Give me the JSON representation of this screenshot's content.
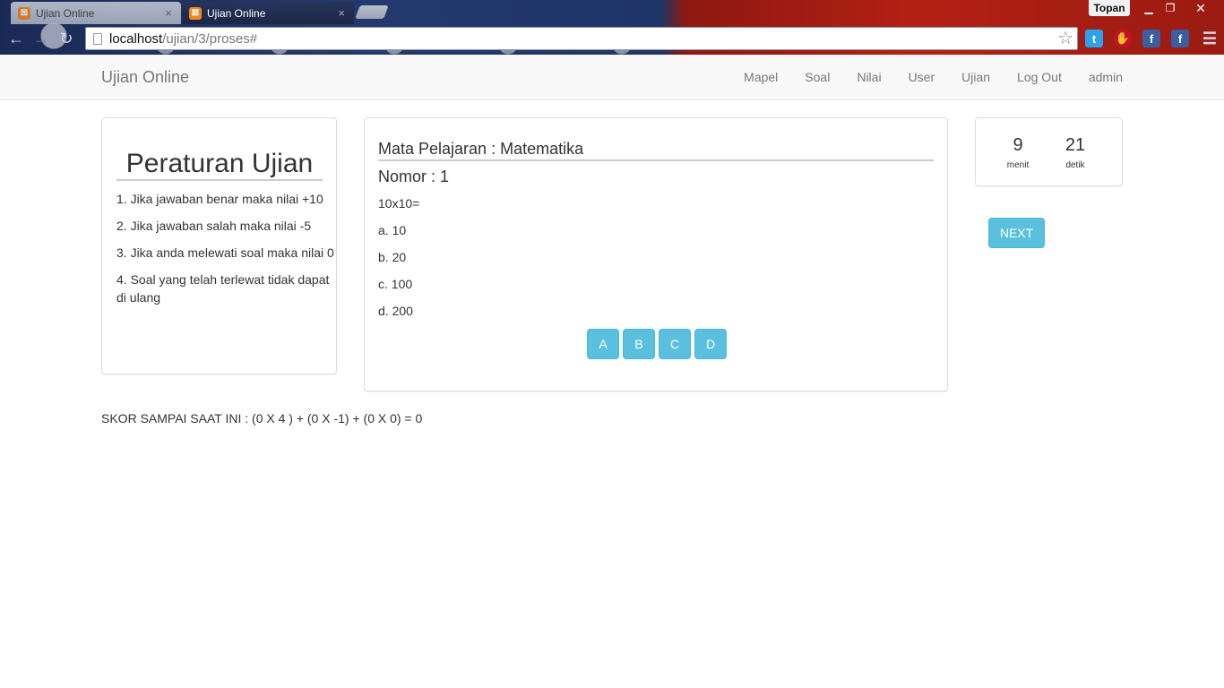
{
  "browser": {
    "tabs": [
      {
        "title": "Ujian Online",
        "active": false
      },
      {
        "title": "Ujian Online",
        "active": true
      }
    ],
    "profile_name": "Topan",
    "url_host": "localhost",
    "url_path": "/ujian/3/proses#"
  },
  "navbar": {
    "brand": "Ujian Online",
    "links": [
      "Mapel",
      "Soal",
      "Nilai",
      "User",
      "Ujian",
      "Log Out",
      "admin"
    ]
  },
  "rules": {
    "title": "Peraturan Ujian",
    "items": [
      "1. Jika jawaban benar maka nilai +10",
      "2. Jika jawaban salah maka nilai -5",
      "3. Jika anda melewati soal maka nilai 0",
      "4. Soal yang telah terlewat tidak dapat di ulang"
    ]
  },
  "question": {
    "subject": "Mata Pelajaran : Matematika",
    "number": "Nomor : 1",
    "text": "10x10=",
    "options": [
      "a. 10",
      "b. 20",
      "c. 100",
      "d. 200"
    ],
    "answer_buttons": [
      "A",
      "B",
      "C",
      "D"
    ]
  },
  "timer": {
    "minutes": "9",
    "minutes_label": "menit",
    "seconds": "21",
    "seconds_label": "detik"
  },
  "next_label": "NEXT",
  "score_text": "SKOR SAMPAI SAAT INI : (0 X 4 ) + (0 X -1) + (0 X 0) = 0",
  "colors": {
    "accent": "#5bc0de",
    "navbar_bg": "#f8f8f8"
  }
}
